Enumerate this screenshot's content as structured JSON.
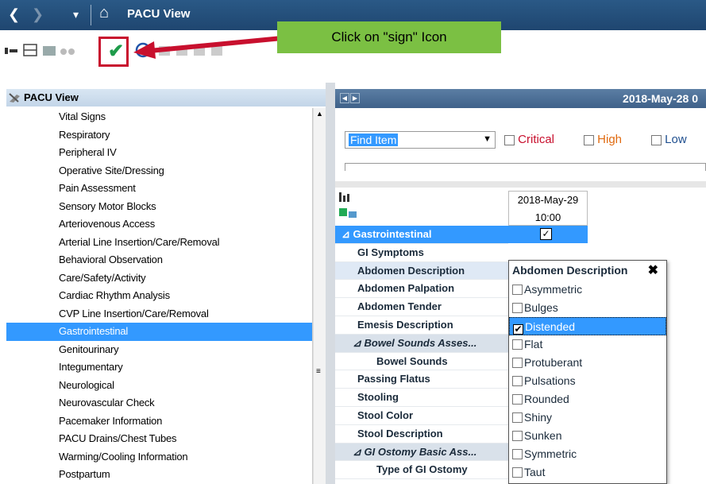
{
  "titlebar": {
    "back_glyph": "❮",
    "forward_glyph": "❯",
    "dropdown_glyph": "▾",
    "home_glyph": "⌂",
    "title": "PACU View"
  },
  "toolbar": {
    "callout_text": "Click on \"sign\" Icon",
    "sign_glyph": "✔",
    "cancel_glyph": "⊘"
  },
  "left_panel": {
    "title": "PACU View",
    "items": [
      "Vital Signs",
      "Respiratory",
      "Peripheral IV",
      "Operative Site/Dressing",
      "Pain Assessment",
      "Sensory Motor Blocks",
      "Arteriovenous Access",
      "Arterial Line Insertion/Care/Removal",
      "Behavioral Observation",
      "Care/Safety/Activity",
      "Cardiac Rhythm Analysis",
      "CVP Line Insertion/Care/Removal",
      "Gastrointestinal",
      "Genitourinary",
      "Integumentary",
      "Neurological",
      "Neurovascular Check",
      "Pacemaker Information",
      "PACU Drains/Chest Tubes",
      "Warming/Cooling Information",
      "Postpartum"
    ],
    "selected_index": 12
  },
  "right_panel": {
    "header_date": "2018-May-28 0",
    "find_item": "Find Item",
    "filters": [
      "Critical",
      "High",
      "Low"
    ],
    "column": {
      "date": "2018-May-29",
      "time": "10:00"
    },
    "rows": [
      {
        "label": "⊿ Gastrointestinal",
        "kind": "group"
      },
      {
        "label": "GI Symptoms",
        "kind": "item"
      },
      {
        "label": "Abdomen Description",
        "kind": "hl"
      },
      {
        "label": "Abdomen Palpation",
        "kind": "item"
      },
      {
        "label": "Abdomen Tender",
        "kind": "item"
      },
      {
        "label": "Emesis Description",
        "kind": "item"
      },
      {
        "label": "⊿ Bowel Sounds Asses...",
        "kind": "sub"
      },
      {
        "label": "Bowel Sounds",
        "kind": "ind"
      },
      {
        "label": "Passing Flatus",
        "kind": "item"
      },
      {
        "label": "Stooling",
        "kind": "item"
      },
      {
        "label": "Stool Color",
        "kind": "item"
      },
      {
        "label": "Stool Description",
        "kind": "item"
      },
      {
        "label": "⊿ GI Ostomy Basic Ass...",
        "kind": "sub"
      },
      {
        "label": "Type of GI Ostomy",
        "kind": "ind"
      }
    ]
  },
  "popup": {
    "title": "Abdomen Description",
    "close_glyph": "✖",
    "options": [
      "Asymmetric",
      "Bulges",
      "Distended",
      "Flat",
      "Protuberant",
      "Pulsations",
      "Rounded",
      "Shiny",
      "Sunken",
      "Symmetric",
      "Taut"
    ],
    "checked": [
      "Distended"
    ]
  },
  "colors": {
    "titlebar": "#1f4670",
    "selection": "#3399ff",
    "callout": "#7bc043",
    "highlight_box": "#c8102e",
    "critical": "#c8102e",
    "high": "#e06a10",
    "low": "#1f4f8f",
    "sign_check": "#1e9b4a"
  }
}
